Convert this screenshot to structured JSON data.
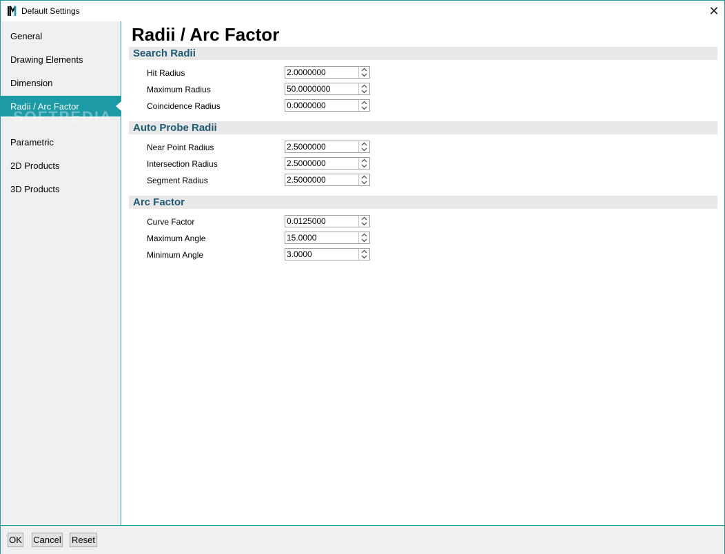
{
  "window": {
    "title": "Default Settings",
    "close_glyph": "✕",
    "accent_color": "#1c9aa6",
    "watermark": "SOFTPEDIA"
  },
  "sidebar": {
    "items": [
      {
        "label": "General",
        "active": false
      },
      {
        "label": "Drawing Elements",
        "active": false
      },
      {
        "label": "Dimension",
        "active": false
      },
      {
        "label": "Radii / Arc Factor",
        "active": true
      },
      {
        "label": "Parametric",
        "active": false
      },
      {
        "label": "2D Products",
        "active": false
      },
      {
        "label": "3D Products",
        "active": false
      }
    ]
  },
  "page": {
    "title": "Radii / Arc Factor",
    "header_color": "#1d5a72"
  },
  "sections": [
    {
      "title": "Search Radii",
      "fields": [
        {
          "label": "Hit Radius",
          "value": "2.0000000"
        },
        {
          "label": "Maximum Radius",
          "value": "50.0000000"
        },
        {
          "label": "Coincidence Radius",
          "value": "0.0000000"
        }
      ]
    },
    {
      "title": "Auto Probe Radii",
      "fields": [
        {
          "label": "Near Point Radius",
          "value": "2.5000000"
        },
        {
          "label": "Intersection Radius",
          "value": "2.5000000"
        },
        {
          "label": "Segment Radius",
          "value": "2.5000000"
        }
      ]
    },
    {
      "title": "Arc Factor",
      "fields": [
        {
          "label": "Curve Factor",
          "value": "0.0125000"
        },
        {
          "label": "Maximum Angle",
          "value": "15.0000"
        },
        {
          "label": "Minimum Angle",
          "value": "3.0000"
        }
      ]
    }
  ],
  "footer": {
    "ok_label": "OK",
    "cancel_label": "Cancel",
    "reset_label": "Reset"
  }
}
